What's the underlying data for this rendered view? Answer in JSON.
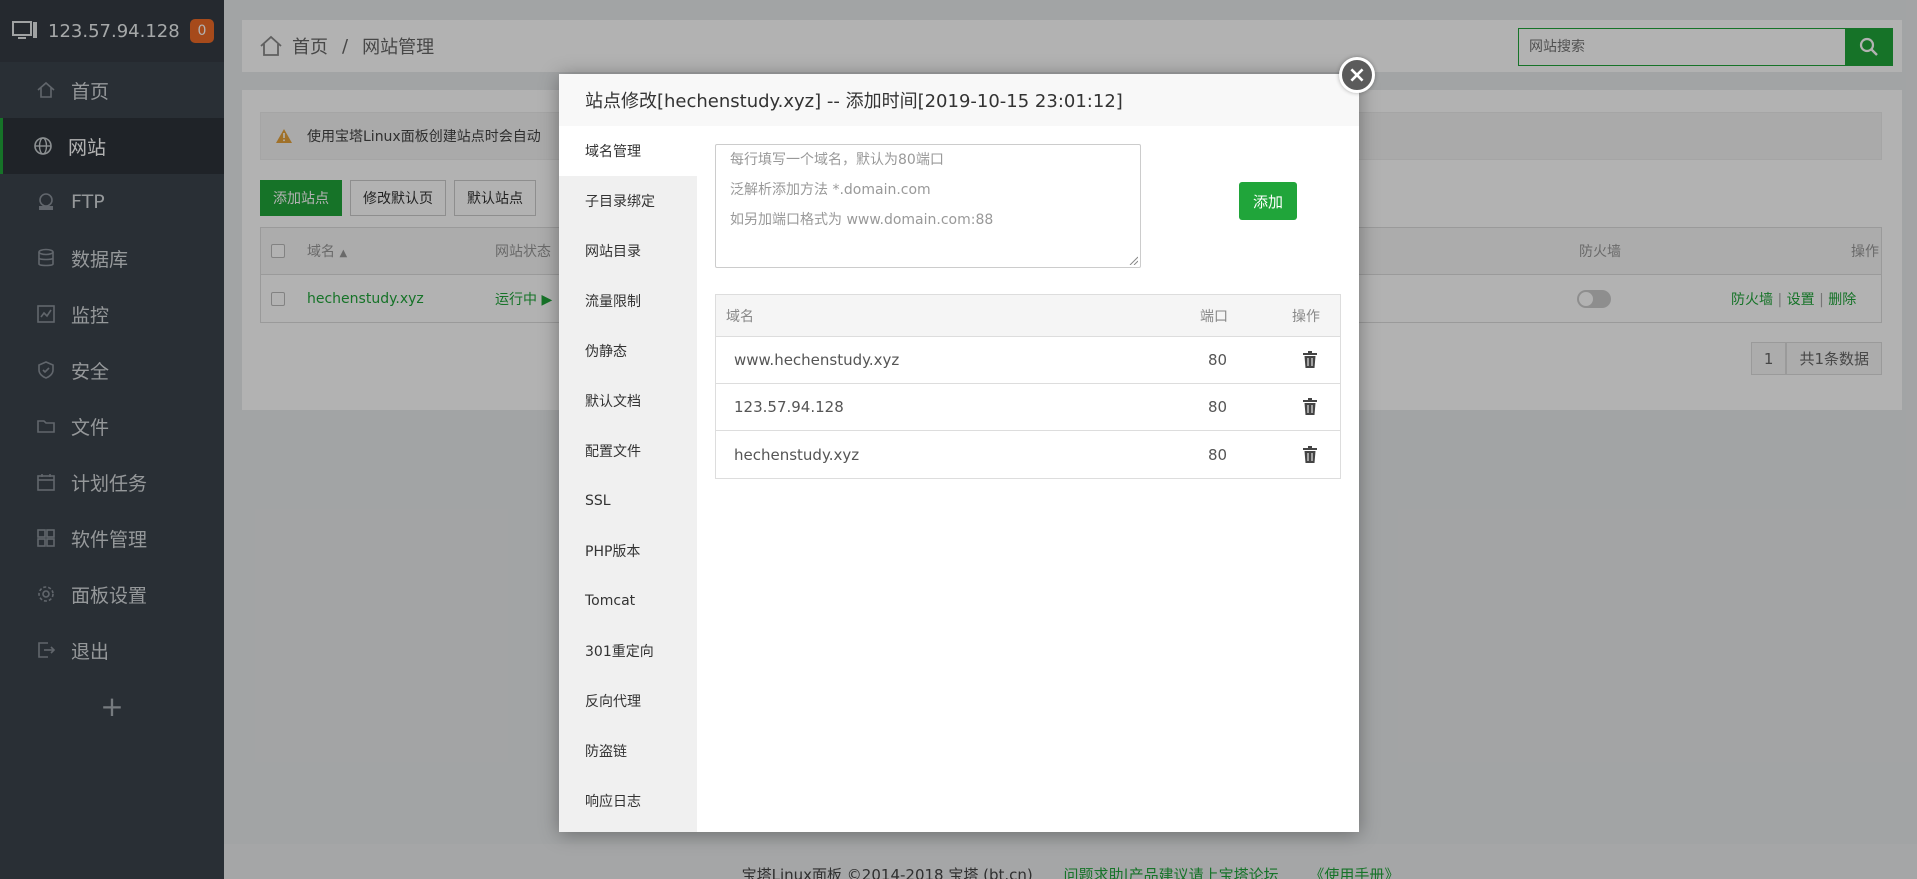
{
  "sidebar": {
    "ip": "123.57.94.128",
    "badge": "0",
    "items": [
      {
        "label": "首页",
        "icon": "home-icon"
      },
      {
        "label": "网站",
        "icon": "globe-icon",
        "active": true
      },
      {
        "label": "FTP",
        "icon": "ftp-icon"
      },
      {
        "label": "数据库",
        "icon": "database-icon"
      },
      {
        "label": "监控",
        "icon": "monitor-icon"
      },
      {
        "label": "安全",
        "icon": "shield-icon"
      },
      {
        "label": "文件",
        "icon": "folder-icon"
      },
      {
        "label": "计划任务",
        "icon": "calendar-icon"
      },
      {
        "label": "软件管理",
        "icon": "grid-icon"
      },
      {
        "label": "面板设置",
        "icon": "gear-icon"
      },
      {
        "label": "退出",
        "icon": "logout-icon"
      }
    ],
    "plus": "+"
  },
  "header": {
    "breadcrumb_home": "首页",
    "breadcrumb_sep": "/",
    "breadcrumb_current": "网站管理",
    "search_placeholder": "网站搜索"
  },
  "page": {
    "alert": "使用宝塔Linux面板创建站点时会自动",
    "buttons": [
      "添加站点",
      "修改默认页",
      "默认站点"
    ],
    "table": {
      "headers": {
        "domain": "域名",
        "status": "网站状态",
        "firewall": "防火墙",
        "actions": "操作"
      },
      "row": {
        "domain": "hechenstudy.xyz",
        "status": "运行中",
        "actions": [
          "防火墙",
          "设置",
          "删除"
        ],
        "action_sep": "|"
      }
    },
    "pager": {
      "page": "1",
      "total": "共1条数据"
    }
  },
  "footer": {
    "copyright": "宝塔Linux面板 ©2014-2018 宝塔 (bt.cn)",
    "link1": "问题求助|产品建议请上宝塔论坛",
    "link2": "《使用手册》"
  },
  "modal": {
    "title": "站点修改[hechenstudy.xyz] -- 添加时间[2019-10-15 23:01:12]",
    "close": "×",
    "nav": [
      "域名管理",
      "子目录绑定",
      "网站目录",
      "流量限制",
      "伪静态",
      "默认文档",
      "配置文件",
      "SSL",
      "PHP版本",
      "Tomcat",
      "301重定向",
      "反向代理",
      "防盗链",
      "响应日志"
    ],
    "placeholder_lines": [
      "每行填写一个域名，默认为80端口",
      "泛解析添加方法 *.domain.com",
      "如另加端口格式为 www.domain.com:88"
    ],
    "add_button": "添加",
    "table": {
      "headers": {
        "domain": "域名",
        "port": "端口",
        "action": "操作"
      },
      "rows": [
        {
          "domain": "www.hechenstudy.xyz",
          "port": "80"
        },
        {
          "domain": "123.57.94.128",
          "port": "80"
        },
        {
          "domain": "hechenstudy.xyz",
          "port": "80"
        }
      ]
    }
  },
  "colors": {
    "accent": "#20a53a",
    "sidebar": "#3c444d",
    "badge": "#ee6a28"
  }
}
